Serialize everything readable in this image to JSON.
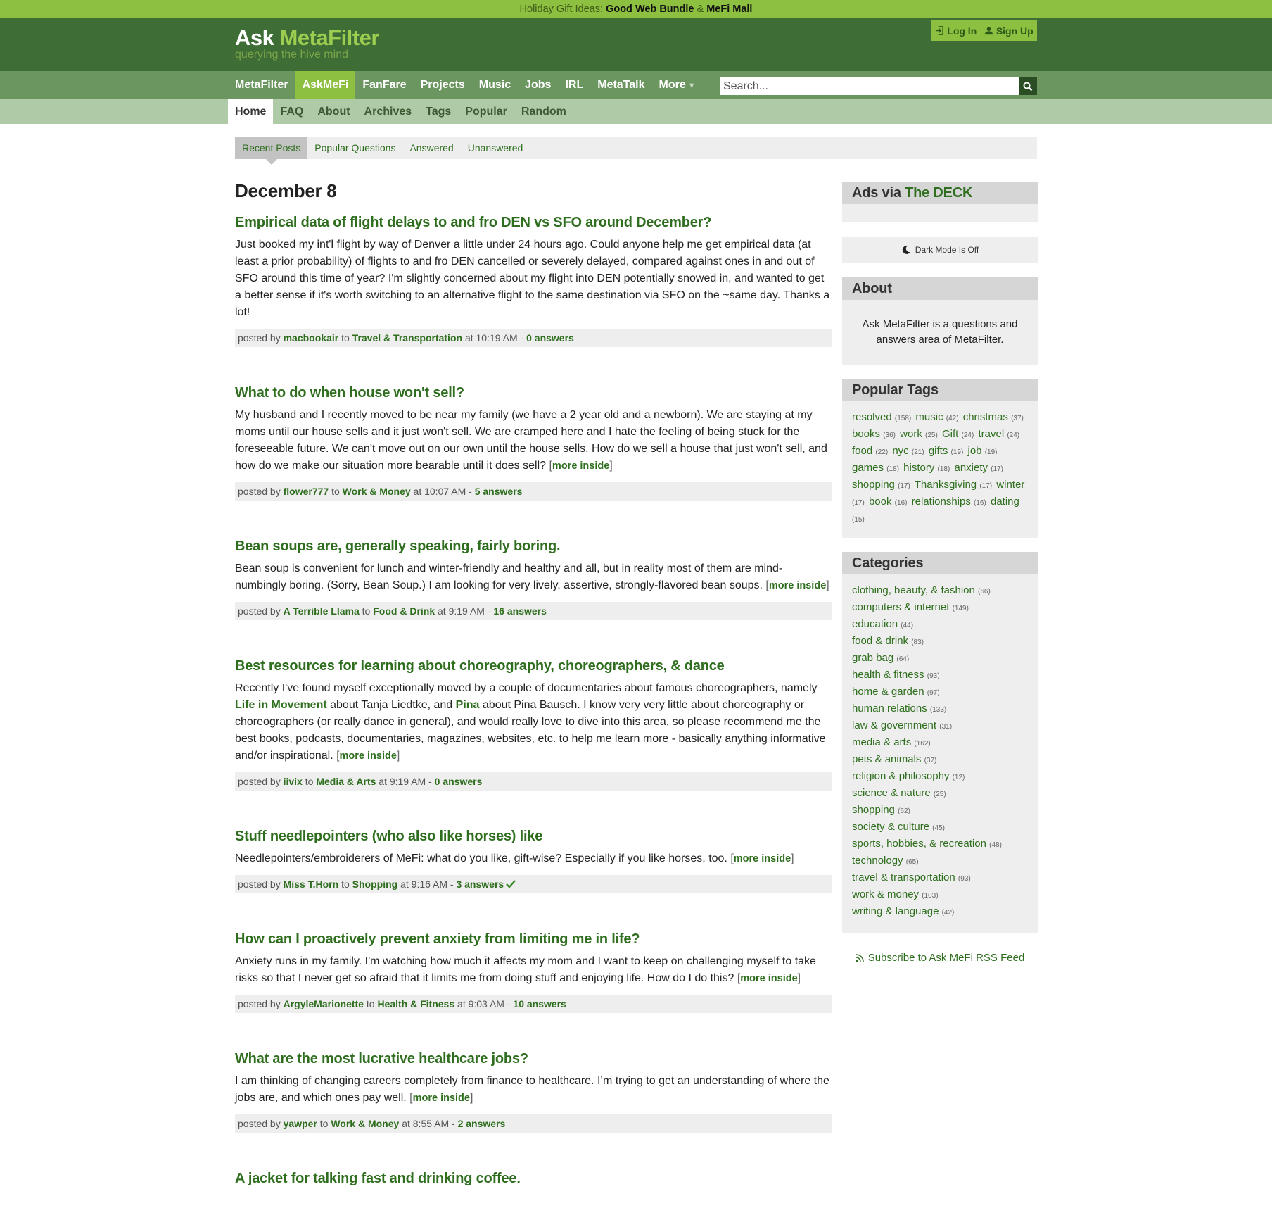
{
  "topbar": {
    "prefix": "Holiday Gift Ideas:",
    "link1": "Good Web Bundle",
    "amp": "&",
    "link2": "MeFi Mall"
  },
  "logo": {
    "ask": "Ask",
    "metafilter": "MetaFilter",
    "tagline": "querying the hive mind"
  },
  "auth": {
    "login": "Log In",
    "signup": "Sign Up"
  },
  "nav1": [
    {
      "label": "MetaFilter",
      "active": false
    },
    {
      "label": "AskMeFi",
      "active": true
    },
    {
      "label": "FanFare",
      "active": false
    },
    {
      "label": "Projects",
      "active": false
    },
    {
      "label": "Music",
      "active": false
    },
    {
      "label": "Jobs",
      "active": false
    },
    {
      "label": "IRL",
      "active": false
    },
    {
      "label": "MetaTalk",
      "active": false
    },
    {
      "label": "More",
      "active": false
    }
  ],
  "search": {
    "placeholder": "Search..."
  },
  "nav2": [
    {
      "label": "Home",
      "active": true
    },
    {
      "label": "FAQ",
      "active": false
    },
    {
      "label": "About",
      "active": false
    },
    {
      "label": "Archives",
      "active": false
    },
    {
      "label": "Tags",
      "active": false
    },
    {
      "label": "Popular",
      "active": false
    },
    {
      "label": "Random",
      "active": false
    }
  ],
  "tabs": [
    {
      "label": "Recent Posts",
      "active": true
    },
    {
      "label": "Popular Questions",
      "active": false
    },
    {
      "label": "Answered",
      "active": false
    },
    {
      "label": "Unanswered",
      "active": false
    }
  ],
  "date": "December 8",
  "posts": [
    {
      "title": "Empirical data of flight delays to and fro DEN vs SFO around December?",
      "body": "Just booked my int'l flight by way of Denver a little under 24 hours ago. Could anyone help me get empirical data (at least a prior probability) of flights to and fro DEN cancelled or severely delayed, compared against ones in and out of SFO around this time of year? I'm slightly concerned about my flight into DEN potentially snowed in, and wanted to get a better sense if it's worth switching to an alternative flight to the same destination via SFO on the ~same day. Thanks a lot!",
      "more": "",
      "user": "macbookair",
      "category": "Travel & Transportation",
      "time": "at 10:19 AM -",
      "answers": "0 answers",
      "resolved": false
    },
    {
      "title": "What to do when house won't sell?",
      "body": "My husband and I recently moved to be near my family (we have a 2 year old and a newborn). We are staying at my moms until our house sells and it just won't sell. We are cramped here and I hate the feeling of being stuck for the foreseeable future. We can't move out on our own until the house sells. How do we sell a house that just won't sell, and how do we make our situation more bearable until it does sell?",
      "more": "more inside",
      "user": "flower777",
      "category": "Work & Money",
      "time": "at 10:07 AM -",
      "answers": "5 answers",
      "resolved": false
    },
    {
      "title": "Bean soups are, generally speaking, fairly boring.",
      "body": "Bean soup is convenient for lunch and winter-friendly and healthy and all, but in reality most of them are mind-numbingly boring. (Sorry, Bean Soup.) I am looking for very lively, assertive, strongly-flavored bean soups.",
      "more": "more inside",
      "user": "A Terrible Llama",
      "category": "Food & Drink",
      "time": "at 9:19 AM -",
      "answers": "16 answers",
      "resolved": false
    },
    {
      "title": "Best resources for learning about choreography, choreographers, & dance",
      "body_parts": [
        "Recently I've found myself exceptionally moved by a couple of documentaries about famous choreographers, namely ",
        "Life in Movement",
        " about Tanja Liedtke, and ",
        "Pina",
        " about Pina Bausch. I know very very little about choreography or choreographers (or really dance in general), and would really love to dive into this area, so please recommend me the best books, podcasts, documentaries, magazines, websites, etc. to help me learn more - basically anything informative and/or inspirational."
      ],
      "more": "more inside",
      "user": "iivix",
      "category": "Media & Arts",
      "time": "at 9:19 AM -",
      "answers": "0 answers",
      "resolved": false
    },
    {
      "title": "Stuff needlepointers (who also like horses) like",
      "body": "Needlepointers/embroiderers of MeFi: what do you like, gift-wise? Especially if you like horses, too.",
      "more": "more inside",
      "user": "Miss T.Horn",
      "category": "Shopping",
      "time": "at 9:16 AM -",
      "answers": "3 answers",
      "resolved": true
    },
    {
      "title": "How can I proactively prevent anxiety from limiting me in life?",
      "body": "Anxiety runs in my family. I'm watching how much it affects my mom and I want to keep on challenging myself to take risks so that I never get so afraid that it limits me from doing stuff and enjoying life. How do I do this?",
      "more": "more inside",
      "user": "ArgyleMarionette",
      "category": "Health & Fitness",
      "time": "at 9:03 AM -",
      "answers": "10 answers",
      "resolved": false
    },
    {
      "title": "What are the most lucrative healthcare jobs?",
      "body": "I am thinking of changing careers completely from finance to healthcare. I’m trying to get an understanding of where the jobs are, and which ones pay well.",
      "more": "more inside",
      "user": "yawper",
      "category": "Work & Money",
      "time": "at 8:55 AM -",
      "answers": "2 answers",
      "resolved": false
    },
    {
      "title": "A jacket for talking fast and drinking coffee.",
      "body": "",
      "more": "",
      "user": "",
      "category": "",
      "time": "",
      "answers": "",
      "resolved": false
    }
  ],
  "meta_posted_by": "posted by",
  "meta_to": "to",
  "sidebar": {
    "ads_prefix": "Ads via",
    "ads_link": "The DECK",
    "dark_mode": "Dark Mode Is Off",
    "about_title": "About",
    "about_text": "Ask MetaFilter is a questions and answers area of MetaFilter.",
    "tags_title": "Popular Tags",
    "tags": [
      {
        "name": "resolved",
        "count": "(158)"
      },
      {
        "name": "music",
        "count": "(42)"
      },
      {
        "name": "christmas",
        "count": "(37)"
      },
      {
        "name": "books",
        "count": "(36)"
      },
      {
        "name": "work",
        "count": "(25)"
      },
      {
        "name": "Gift",
        "count": "(24)"
      },
      {
        "name": "travel",
        "count": "(24)"
      },
      {
        "name": "food",
        "count": "(22)"
      },
      {
        "name": "nyc",
        "count": "(21)"
      },
      {
        "name": "gifts",
        "count": "(19)"
      },
      {
        "name": "job",
        "count": "(19)"
      },
      {
        "name": "games",
        "count": "(18)"
      },
      {
        "name": "history",
        "count": "(18)"
      },
      {
        "name": "anxiety",
        "count": "(17)"
      },
      {
        "name": "shopping",
        "count": "(17)"
      },
      {
        "name": "Thanksgiving",
        "count": "(17)"
      },
      {
        "name": "winter",
        "count": "(17)"
      },
      {
        "name": "book",
        "count": "(16)"
      },
      {
        "name": "relationships",
        "count": "(16)"
      },
      {
        "name": "dating",
        "count": "(15)"
      }
    ],
    "cats_title": "Categories",
    "categories": [
      {
        "name": "clothing, beauty, & fashion",
        "count": "(66)"
      },
      {
        "name": "computers & internet",
        "count": "(149)"
      },
      {
        "name": "education",
        "count": "(44)"
      },
      {
        "name": "food & drink",
        "count": "(83)"
      },
      {
        "name": "grab bag",
        "count": "(64)"
      },
      {
        "name": "health & fitness",
        "count": "(93)"
      },
      {
        "name": "home & garden",
        "count": "(97)"
      },
      {
        "name": "human relations",
        "count": "(133)"
      },
      {
        "name": "law & government",
        "count": "(31)"
      },
      {
        "name": "media & arts",
        "count": "(162)"
      },
      {
        "name": "pets & animals",
        "count": "(37)"
      },
      {
        "name": "religion & philosophy",
        "count": "(12)"
      },
      {
        "name": "science & nature",
        "count": "(25)"
      },
      {
        "name": "shopping",
        "count": "(62)"
      },
      {
        "name": "society & culture",
        "count": "(45)"
      },
      {
        "name": "sports, hobbies, & recreation",
        "count": "(48)"
      },
      {
        "name": "technology",
        "count": "(65)"
      },
      {
        "name": "travel & transportation",
        "count": "(93)"
      },
      {
        "name": "work & money",
        "count": "(103)"
      },
      {
        "name": "writing & language",
        "count": "(42)"
      }
    ],
    "rss": "Subscribe to Ask MeFi RSS Feed"
  }
}
